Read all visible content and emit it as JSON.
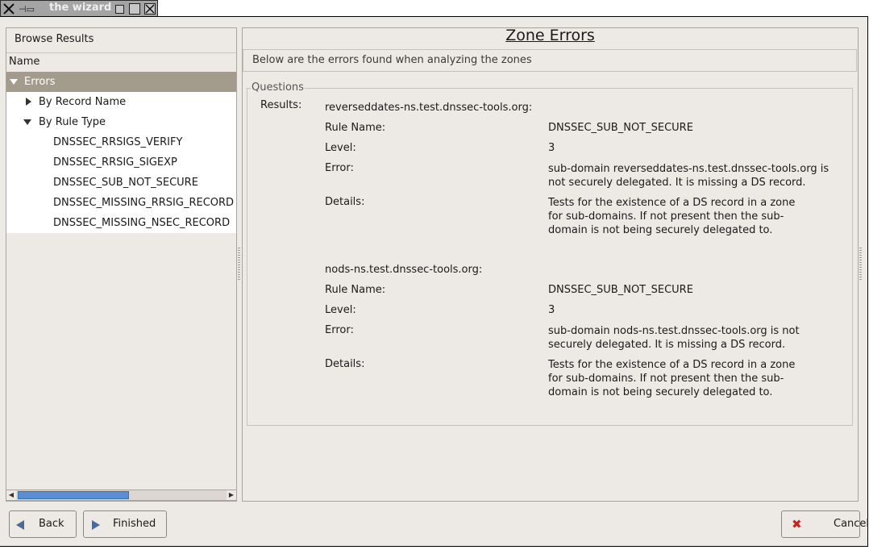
{
  "window": {
    "title": "the wizard"
  },
  "left": {
    "panel_title": "Browse Results",
    "column_header": "Name",
    "tree": [
      {
        "label": "Errors",
        "level": 0,
        "expanded": true,
        "selected": true
      },
      {
        "label": "By Record Name",
        "level": 1,
        "expanded": false
      },
      {
        "label": "By Rule Type",
        "level": 1,
        "expanded": true
      },
      {
        "label": "DNSSEC_RRSIGS_VERIFY",
        "level": 2
      },
      {
        "label": "DNSSEC_RRSIG_SIGEXP",
        "level": 2
      },
      {
        "label": "DNSSEC_SUB_NOT_SECURE",
        "level": 2
      },
      {
        "label": "DNSSEC_MISSING_RRSIG_RECORD",
        "level": 2
      },
      {
        "label": "DNSSEC_MISSING_NSEC_RECORD",
        "level": 2
      }
    ]
  },
  "main": {
    "title": "Zone Errors",
    "description": "Below are the errors found when analyzing the zones",
    "frame_label": "Questions",
    "results_label": "Results:",
    "results": [
      {
        "zone": "reverseddates-ns.test.dnssec-tools.org:",
        "rule_label": "Rule Name:",
        "rule": "DNSSEC_SUB_NOT_SECURE",
        "level_label": "Level:",
        "level": "3",
        "error_label": "Error:",
        "error": "sub-domain reverseddates-ns.test.dnssec-tools.org is not securely delegated.  It is missing a DS record.",
        "details_label": "Details:",
        "details": "Tests for the existence of a DS record in a zone for sub-domains.  If not present then the sub-domain is not being securely delegated to."
      },
      {
        "zone": "nods-ns.test.dnssec-tools.org:",
        "rule_label": "Rule Name:",
        "rule": "DNSSEC_SUB_NOT_SECURE",
        "level_label": "Level:",
        "level": "3",
        "error_label": "Error:",
        "error": "sub-domain nods-ns.test.dnssec-tools.org is not securely delegated.  It is missing a DS record.",
        "details_label": "Details:",
        "details": "Tests for the existence of a DS record in a zone for sub-domains.  If not present then the sub-domain is not being securely delegated to."
      }
    ]
  },
  "buttons": {
    "back": "Back",
    "finished": "Finished",
    "cancel": "Cancel"
  },
  "colors": {
    "selection": "#a39b8c",
    "background": "#edeae5",
    "scroll_thumb": "#5a8ed0"
  }
}
